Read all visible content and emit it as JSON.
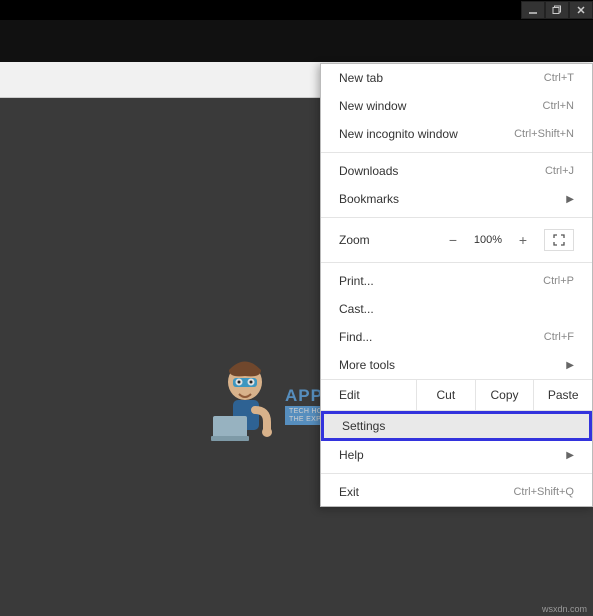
{
  "menu": {
    "new_tab": {
      "label": "New tab",
      "shortcut": "Ctrl+T"
    },
    "new_window": {
      "label": "New window",
      "shortcut": "Ctrl+N"
    },
    "new_incognito": {
      "label": "New incognito window",
      "shortcut": "Ctrl+Shift+N"
    },
    "downloads": {
      "label": "Downloads",
      "shortcut": "Ctrl+J"
    },
    "bookmarks": {
      "label": "Bookmarks"
    },
    "zoom": {
      "label": "Zoom",
      "minus": "−",
      "value": "100%",
      "plus": "+"
    },
    "print": {
      "label": "Print...",
      "shortcut": "Ctrl+P"
    },
    "cast": {
      "label": "Cast..."
    },
    "find": {
      "label": "Find...",
      "shortcut": "Ctrl+F"
    },
    "more_tools": {
      "label": "More tools"
    },
    "edit": {
      "label": "Edit",
      "cut": "Cut",
      "copy": "Copy",
      "paste": "Paste"
    },
    "settings": {
      "label": "Settings"
    },
    "help": {
      "label": "Help"
    },
    "exit": {
      "label": "Exit",
      "shortcut": "Ctrl+Shift+Q"
    }
  },
  "watermark": {
    "title": "APPUALS",
    "sub": "TECH HOW-TO'S FROM THE EXPERTS"
  },
  "footer": "wsxdn.com"
}
